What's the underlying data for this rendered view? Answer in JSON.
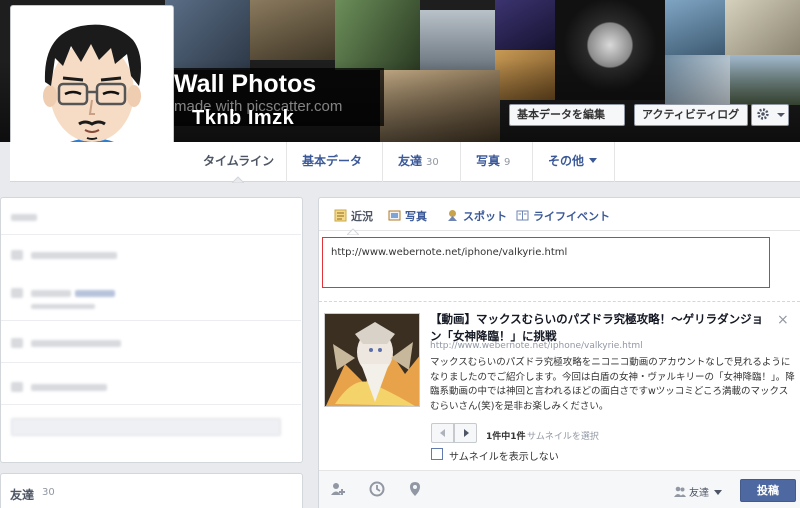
{
  "cover": {
    "wall_title": "Wall Photos",
    "wall_subtitle": "made with picscatter.com",
    "profile_name": "Tknb Imzk",
    "edit_profile_button": "基本データを編集",
    "activity_log_button": "アクティビティログ"
  },
  "nav": {
    "timeline": "タイムライン",
    "about": "基本データ",
    "friends": "友達",
    "friends_count": "30",
    "photos": "写真",
    "photos_count": "9",
    "more": "その他"
  },
  "left": {
    "friends_label": "友達",
    "friends_count": "30"
  },
  "composer": {
    "tabs": {
      "status": "近況",
      "photo": "写真",
      "spot": "スポット",
      "life_event": "ライフイベント"
    },
    "input_value": "http://www.webernote.net/iphone/valkyrie.html",
    "preview": {
      "title": "【動画】マックスむらいのパズドラ究極攻略！～ゲリラダンジョン「女神降臨！」に挑戦",
      "url": "http://www.webernote.net/iphone/valkyrie.html",
      "description": "マックスむらいのパズドラ究極攻略をニコニコ動画のアカウントなしで見れるようになりましたのでご紹介します。今回は白盾の女神・ヴァルキリーの「女神降臨！」。降臨系動画の中では神回と言われるほどの面白さですwツッコミどころ満載のマックスむらいさん(笑)を是非お楽しみください。",
      "close": "×"
    },
    "pager_count": "1件中1件",
    "pager_select": "サムネイルを選択",
    "no_thumbnail_label": "サムネイルを表示しない",
    "audience": "友達",
    "post_button": "投稿"
  },
  "colors": {
    "brand_blue": "#3b5998",
    "post_button": "#4e69a2",
    "input_border": "#e0343a",
    "page_bg": "#e9eaed"
  }
}
